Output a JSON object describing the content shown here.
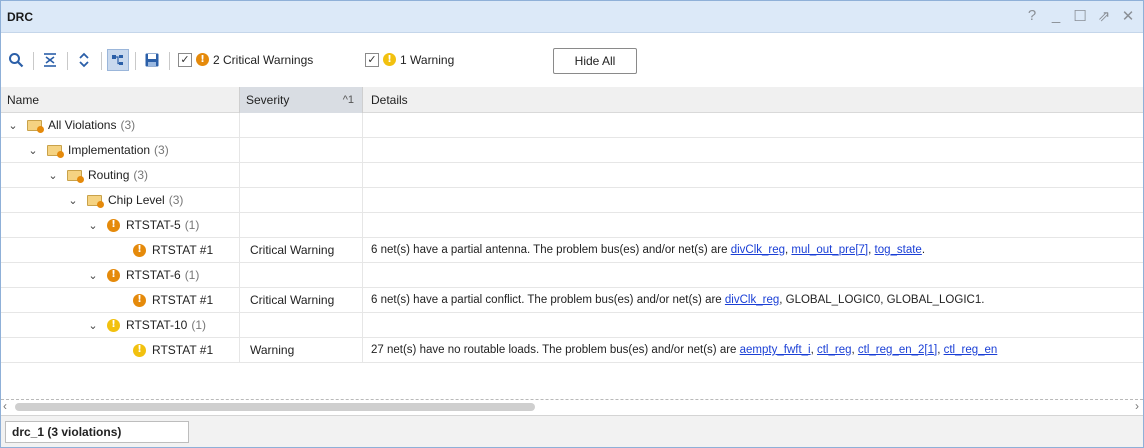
{
  "window": {
    "title": "DRC",
    "controls": [
      "?",
      "_",
      "☐",
      "⇗",
      "✕"
    ]
  },
  "toolbar": {
    "icons": [
      "search-icon",
      "collapse-all-icon",
      "expand-all-icon",
      "group-by-icon",
      "save-icon"
    ],
    "filter_critical": {
      "checked": true,
      "label": "2 Critical Warnings"
    },
    "filter_warning": {
      "checked": true,
      "label": "1 Warning"
    },
    "hide_all_label": "Hide All"
  },
  "columns": {
    "name": "Name",
    "severity": "Severity",
    "severity_sort": "^1",
    "details": "Details"
  },
  "rows": [
    {
      "label": "All Violations",
      "count": "(3)"
    },
    {
      "label": "Implementation",
      "count": "(3)"
    },
    {
      "label": "Routing",
      "count": "(3)"
    },
    {
      "label": "Chip Level",
      "count": "(3)"
    },
    {
      "label": "RTSTAT-5",
      "count": "(1)"
    },
    {
      "label": "RTSTAT #1",
      "severity": "Critical Warning",
      "details_text": "6 net(s) have a partial antenna. The problem bus(es) and/or net(s) are ",
      "links": [
        "divClk_reg",
        "mul_out_pre[7]",
        "tog_state"
      ],
      "tail": "."
    },
    {
      "label": "RTSTAT-6",
      "count": "(1)"
    },
    {
      "label": "RTSTAT #1",
      "severity": "Critical Warning",
      "details_text": "6 net(s) have a partial conflict. The problem bus(es) and/or net(s) are ",
      "links": [
        "divClk_reg"
      ],
      "tail": ", GLOBAL_LOGIC0, GLOBAL_LOGIC1."
    },
    {
      "label": "RTSTAT-10",
      "count": "(1)"
    },
    {
      "label": "RTSTAT #1",
      "severity": "Warning",
      "details_text": "27 net(s) have no routable loads. The problem bus(es) and/or net(s) are ",
      "links": [
        "aempty_fwft_i",
        "ctl_reg",
        "ctl_reg_en_2[1]",
        "ctl_reg_en"
      ],
      "tail": ""
    }
  ],
  "status_tab": "drc_1 (3 violations)",
  "colors": {
    "critical": "#e58a0b",
    "warning": "#f2c10f",
    "link": "#1a3fd6",
    "titlebar": "#dce9f8"
  }
}
